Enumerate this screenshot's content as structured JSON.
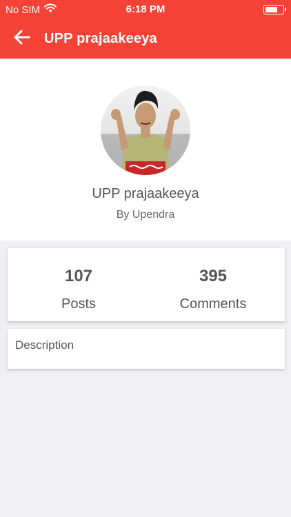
{
  "status_bar": {
    "carrier": "No SIM",
    "time": "6:18 PM",
    "battery_level": 0.6
  },
  "nav": {
    "title": "UPP prajaakeeya",
    "back_icon": "back-arrow-icon"
  },
  "profile": {
    "name": "UPP prajaakeeya",
    "author": "By Upendra"
  },
  "stats": {
    "posts_count": "107",
    "posts_label": "Posts",
    "comments_count": "395",
    "comments_label": "Comments"
  },
  "description": {
    "label": "Description"
  },
  "colors": {
    "accent": "#f44336",
    "background": "#efeff4",
    "text": "#555555"
  }
}
